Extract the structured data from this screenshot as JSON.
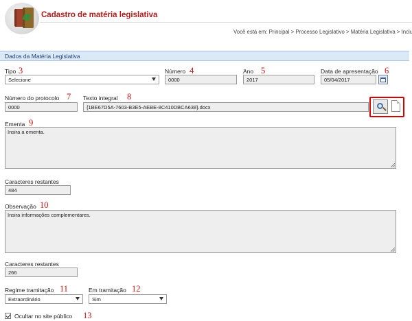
{
  "header": {
    "title": "Cadastro de matéria legislativa",
    "breadcrumb": "Você está em: Principal > Processo Legislativo > Matéria Legislativa > Incluir",
    "logo_icon": "law-books-icon"
  },
  "section": {
    "title": "Dados da Matéria Legislativa"
  },
  "fields": {
    "tipo": {
      "label": "Tipo",
      "value": "Selecione",
      "marker": "3"
    },
    "numero": {
      "label": "Número",
      "value": "0000",
      "marker": "4"
    },
    "ano": {
      "label": "Ano",
      "value": "2017",
      "marker": "5"
    },
    "data": {
      "label": "Data de apresentação",
      "value": "05/04/2017",
      "marker": "6"
    },
    "protocolo": {
      "label": "Número do protocolo",
      "value": "0000",
      "marker": "7"
    },
    "texto": {
      "label": "Texto integral",
      "value": "{1BE67D5A-7603-B3E5-AEBE-8C410DBCA638}.docx",
      "marker": "8"
    },
    "ementa": {
      "label": "Ementa",
      "placeholder": "Insira a ementa.",
      "marker": "9"
    },
    "ementa_rest": {
      "label": "Caracteres restantes",
      "value": "484"
    },
    "observacao": {
      "label": "Observação",
      "placeholder": "Insira informações complementares.",
      "marker": "10"
    },
    "obs_rest": {
      "label": "Caracteres restantes",
      "value": "266"
    },
    "regime": {
      "label": "Regime tramitação",
      "value": "Extraordinário",
      "marker": "11"
    },
    "em_tramitacao": {
      "label": "Em tramitação",
      "value": "Sim",
      "marker": "12"
    },
    "ocultar": {
      "label": "Ocultar no site público",
      "checked": true,
      "marker": "13"
    }
  },
  "colors": {
    "title_red": "#b41a1a",
    "highlight": "#d40000",
    "section_bg": "#dbe8f6"
  }
}
